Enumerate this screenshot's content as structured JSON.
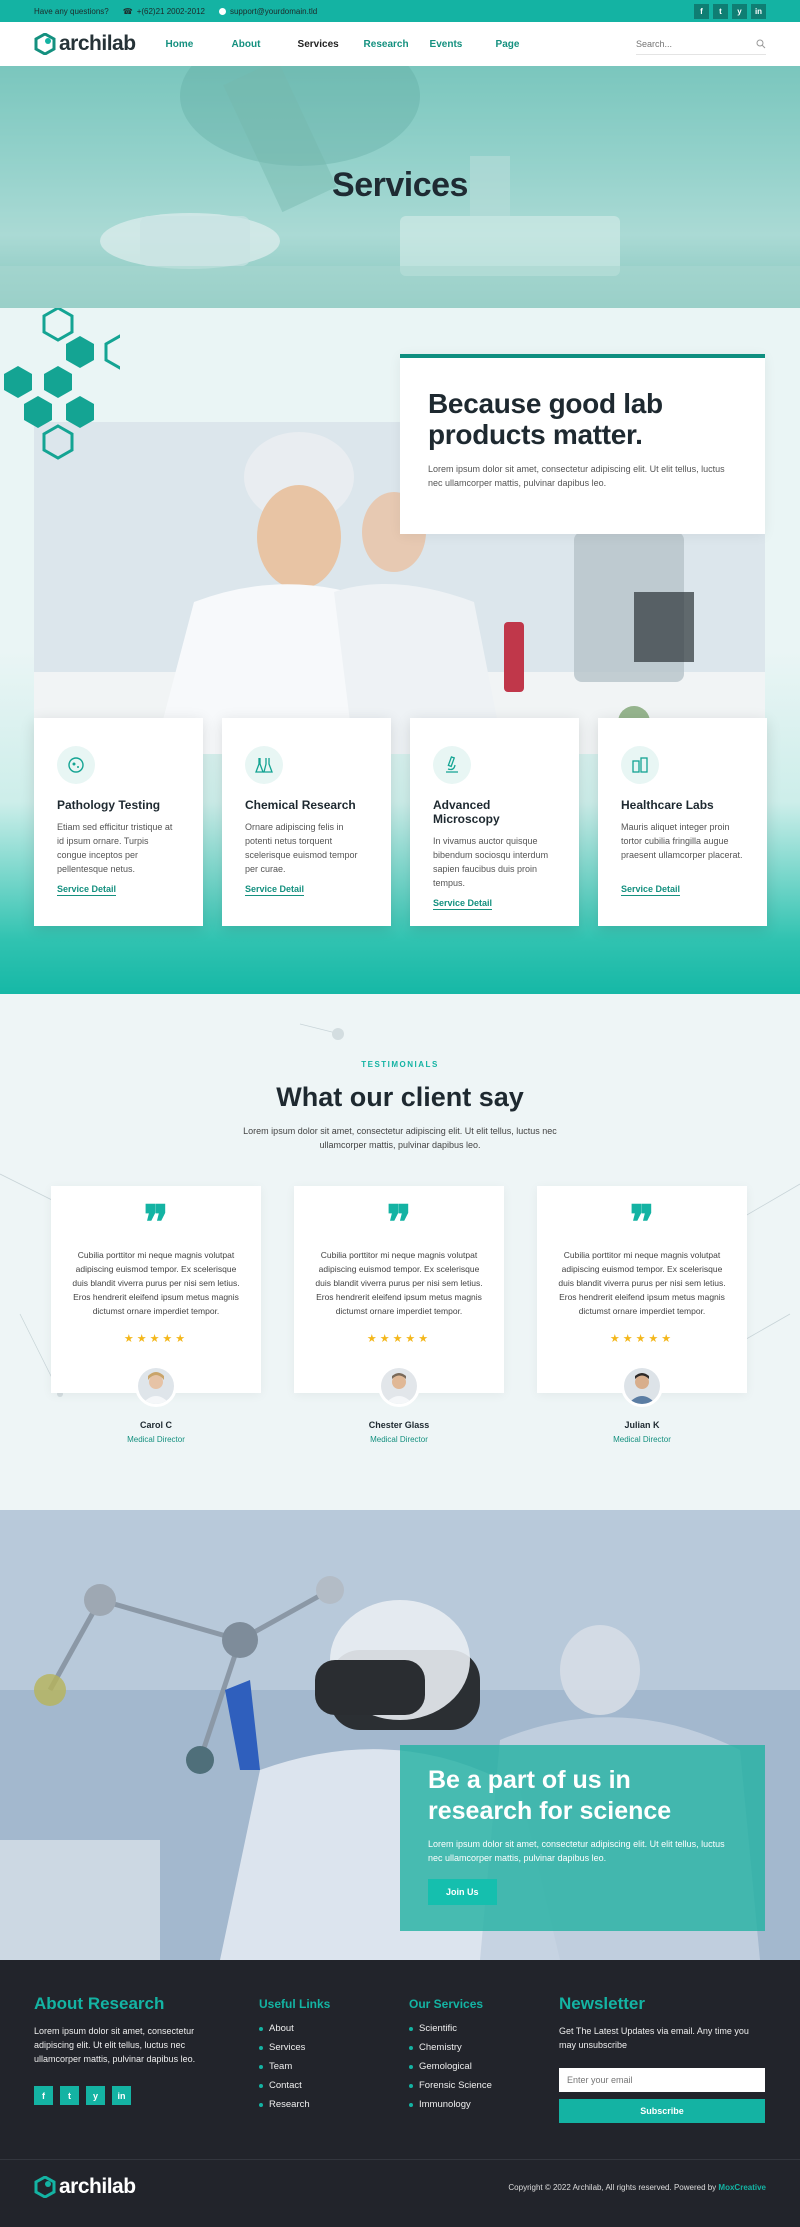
{
  "topbar": {
    "question": "Have any questions?",
    "phone": "+(62)21 2002-2012",
    "email": "support@yourdomain.tld",
    "socials": [
      "f",
      "t",
      "y",
      "in"
    ]
  },
  "nav": {
    "logo": "archilab",
    "menu": [
      "Home",
      "About",
      "Services",
      "Research",
      "Events",
      "Page"
    ],
    "search_placeholder": "Search..."
  },
  "hero": {
    "title": "Services"
  },
  "intro": {
    "title": "Because good lab products matter.",
    "text": "Lorem ipsum dolor sit amet, consectetur adipiscing elit. Ut elit tellus, luctus nec ullamcorper mattis, pulvinar dapibus leo."
  },
  "services": [
    {
      "title": "Pathology Testing",
      "text": "Etiam sed efficitur tristique at id ipsum ornare. Turpis congue inceptos per pellentesque netus.",
      "link": "Service Detail",
      "icon": "pathology-icon"
    },
    {
      "title": "Chemical Research",
      "text": "Ornare adipiscing felis in potenti netus torquent scelerisque euismod tempor per curae.",
      "link": "Service Detail",
      "icon": "flask-icon"
    },
    {
      "title": "Advanced Microscopy",
      "text": "In vivamus auctor quisque bibendum sociosqu interdum sapien faucibus duis proin tempus.",
      "link": "Service Detail",
      "icon": "microscope-icon"
    },
    {
      "title": "Healthcare Labs",
      "text": "Mauris aliquet integer proin tortor cubilia fringilla augue praesent ullamcorper placerat.",
      "link": "Service Detail",
      "icon": "lab-jars-icon"
    }
  ],
  "testimonials": {
    "eyebrow": "TESTIMONIALS",
    "title": "What our client say",
    "lead": "Lorem ipsum dolor sit amet, consectetur adipiscing elit. Ut elit tellus, luctus nec ullamcorper mattis, pulvinar dapibus leo.",
    "items": [
      {
        "quote": "Cubilia porttitor mi neque magnis volutpat adipiscing euismod tempor. Ex scelerisque duis blandit viverra purus per nisi sem letius. Eros hendrerit eleifend ipsum metus magnis dictumst ornare imperdiet tempor.",
        "stars": "★★★★★",
        "name": "Carol C",
        "role": "Medical Director"
      },
      {
        "quote": "Cubilia porttitor mi neque magnis volutpat adipiscing euismod tempor. Ex scelerisque duis blandit viverra purus per nisi sem letius. Eros hendrerit eleifend ipsum metus magnis dictumst ornare imperdiet tempor.",
        "stars": "★★★★★",
        "name": "Chester Glass",
        "role": "Medical Director"
      },
      {
        "quote": "Cubilia porttitor mi neque magnis volutpat adipiscing euismod tempor. Ex scelerisque duis blandit viverra purus per nisi sem letius. Eros hendrerit eleifend ipsum metus magnis dictumst ornare imperdiet tempor.",
        "stars": "★★★★★",
        "name": "Julian K",
        "role": "Medical Director"
      }
    ]
  },
  "cta": {
    "title": "Be a part of us in research for science",
    "text": "Lorem ipsum dolor sit amet, consectetur adipiscing elit. Ut elit tellus, luctus nec ullamcorper mattis, pulvinar dapibus leo.",
    "button": "Join Us"
  },
  "footer": {
    "about_title": "About Research",
    "about_text": "Lorem ipsum dolor sit amet, consectetur adipiscing elit. Ut elit tellus, luctus nec ullamcorper mattis, pulvinar dapibus leo.",
    "socials": [
      "f",
      "t",
      "y",
      "in"
    ],
    "links_title": "Useful Links",
    "links": [
      "About",
      "Services",
      "Team",
      "Contact",
      "Research"
    ],
    "services_title": "Our Services",
    "services": [
      "Scientific",
      "Chemistry",
      "Gemological",
      "Forensic Science",
      "Immunology"
    ],
    "newsletter_title": "Newsletter",
    "newsletter_text": "Get The Latest Updates via email. Any time you may unsubscribe",
    "email_placeholder": "Enter your email",
    "subscribe": "Subscribe",
    "logo": "archilab",
    "copyright": "Copyright © 2022 Archilab, All rights reserved. Powered by",
    "powered": "MoxCreative"
  },
  "colors": {
    "accent": "#14b3a3",
    "dark": "#22242b",
    "heading": "#1e2930"
  }
}
